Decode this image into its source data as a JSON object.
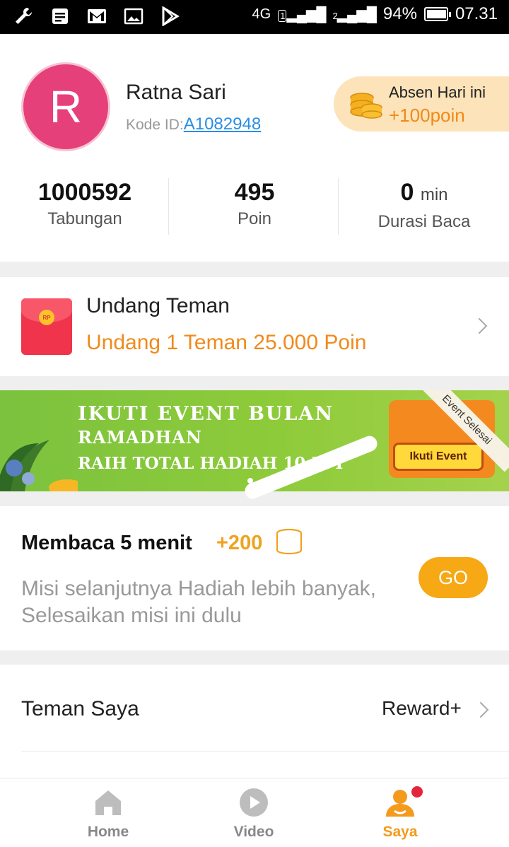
{
  "status_bar": {
    "network": "4G",
    "sim1": "1",
    "sim2": "2",
    "battery": "94%",
    "time": "07.31",
    "icons": [
      "wrench-icon",
      "message-icon",
      "gmail-icon",
      "image-icon",
      "play-store-icon"
    ]
  },
  "profile": {
    "avatar_letter": "R",
    "name": "Ratna Sari",
    "code_label": "Kode ID:",
    "code_value": "A1082948",
    "checkin_title": "Absen Hari ini",
    "checkin_points": "+100poin"
  },
  "stats": [
    {
      "value": "1000592",
      "unit": "",
      "label": "Tabungan"
    },
    {
      "value": "495",
      "unit": "",
      "label": "Poin"
    },
    {
      "value": "0",
      "unit": "min",
      "label": "Durasi Baca"
    }
  ],
  "invite": {
    "envelope_text": "RP",
    "title": "Undang Teman",
    "subtitle": "Undang 1 Teman 25.000 Poin"
  },
  "banner": {
    "line1": "IKUTI EVENT BULAN",
    "line2": "RAMADHAN",
    "line3": "RAIH TOTAL HADIAH 10 JUT",
    "cta": "Ikuti Event",
    "ribbon": "Event Selesai",
    "slides": 2,
    "active_slide": 2
  },
  "mission": {
    "title": "Membaca 5 menit",
    "points": "+200",
    "description_line1": "Misi selanjutnya Hadiah lebih banyak,",
    "description_line2": "Selesaikan misi ini dulu",
    "button": "GO"
  },
  "friends": {
    "label": "Teman Saya",
    "reward": "Reward+"
  },
  "bottom_nav": [
    {
      "label": "Home",
      "icon": "home-icon",
      "active": false
    },
    {
      "label": "Video",
      "icon": "play-circle-icon",
      "active": false
    },
    {
      "label": "Saya",
      "icon": "user-icon",
      "active": true
    }
  ],
  "colors": {
    "accent": "#f49a1c",
    "avatar": "#e5407a",
    "link": "#2a8ee5",
    "go_button": "#f6a815",
    "banner_green": "#8ecb3a"
  }
}
